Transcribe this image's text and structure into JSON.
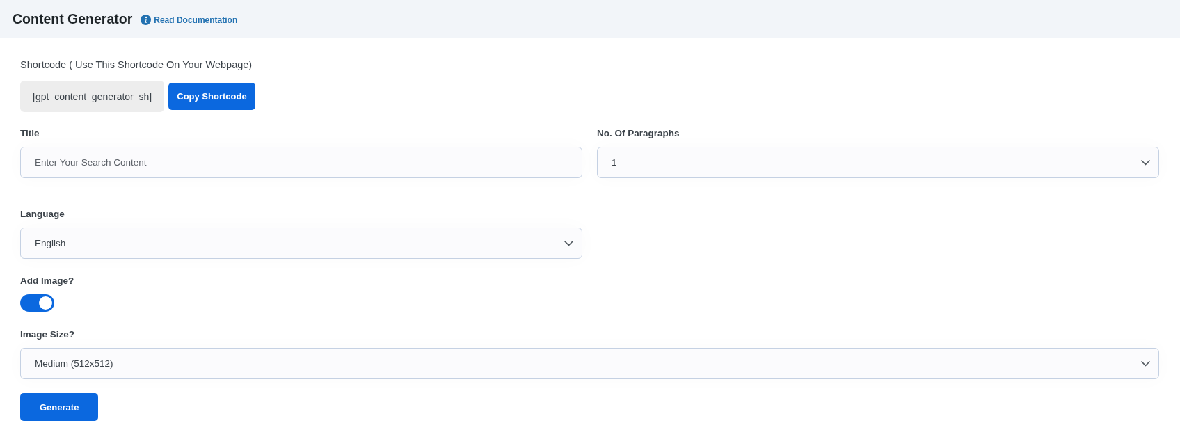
{
  "header": {
    "title": "Content Generator",
    "doc_link": "Read Documentation"
  },
  "shortcode": {
    "label": "Shortcode ( Use This Shortcode On Your Webpage)",
    "value": "[gpt_content_generator_sh]",
    "button": "Copy Shortcode"
  },
  "fields": [
    {
      "kind": "text",
      "label": "Title",
      "placeholder": "Enter Your Search Content"
    },
    {
      "kind": "select",
      "label": "No. Of Paragraphs",
      "value": "1"
    },
    {
      "kind": "select",
      "label": "Language",
      "value": "English"
    }
  ],
  "add_image": {
    "label": "Add Image?",
    "on": true
  },
  "image_size": {
    "label": "Image Size?",
    "value": "Medium (512x512)"
  },
  "generate_button": "Generate"
}
